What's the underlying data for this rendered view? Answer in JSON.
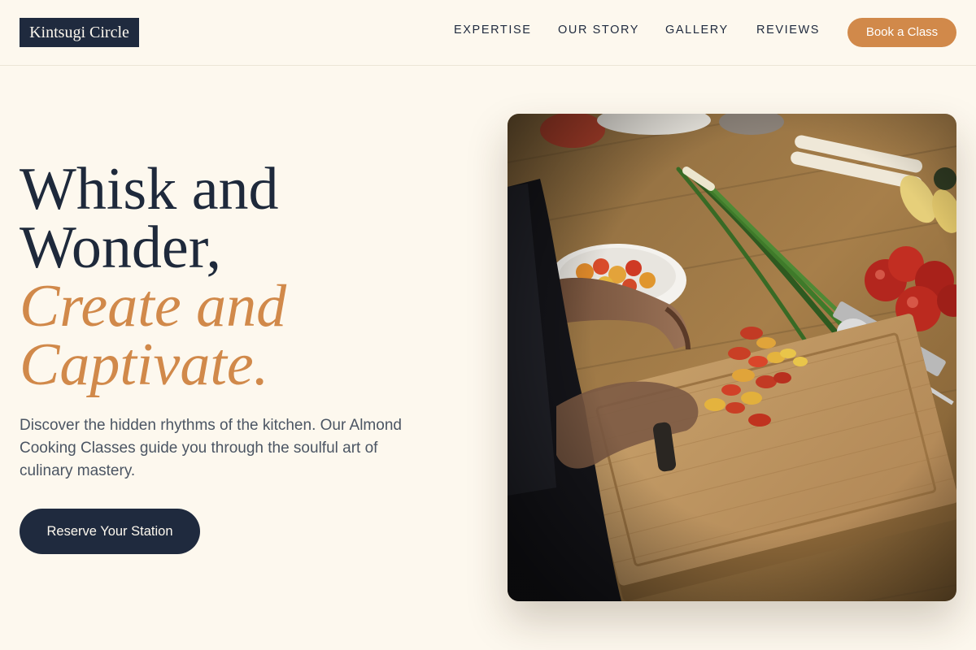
{
  "header": {
    "logo": "Kintsugi Circle",
    "nav": [
      {
        "label": "EXPERTISE"
      },
      {
        "label": "OUR STORY"
      },
      {
        "label": "GALLERY"
      },
      {
        "label": "REVIEWS"
      }
    ],
    "book_button": "Book a Class"
  },
  "hero": {
    "title_line1": "Whisk and",
    "title_line2": "Wonder,",
    "title_accent1": "Create and",
    "title_accent2": "Captivate.",
    "description": "Discover the hidden rhythms of the kitchen. Our Almond Cooking Classes guide you through the soulful art of culinary mastery.",
    "cta": "Reserve Your Station",
    "image_alt": "Chef slicing cherry tomatoes on a wooden cutting board"
  },
  "colors": {
    "background": "#fdf8ee",
    "navy": "#1f2a3e",
    "accent": "#d1894a"
  }
}
